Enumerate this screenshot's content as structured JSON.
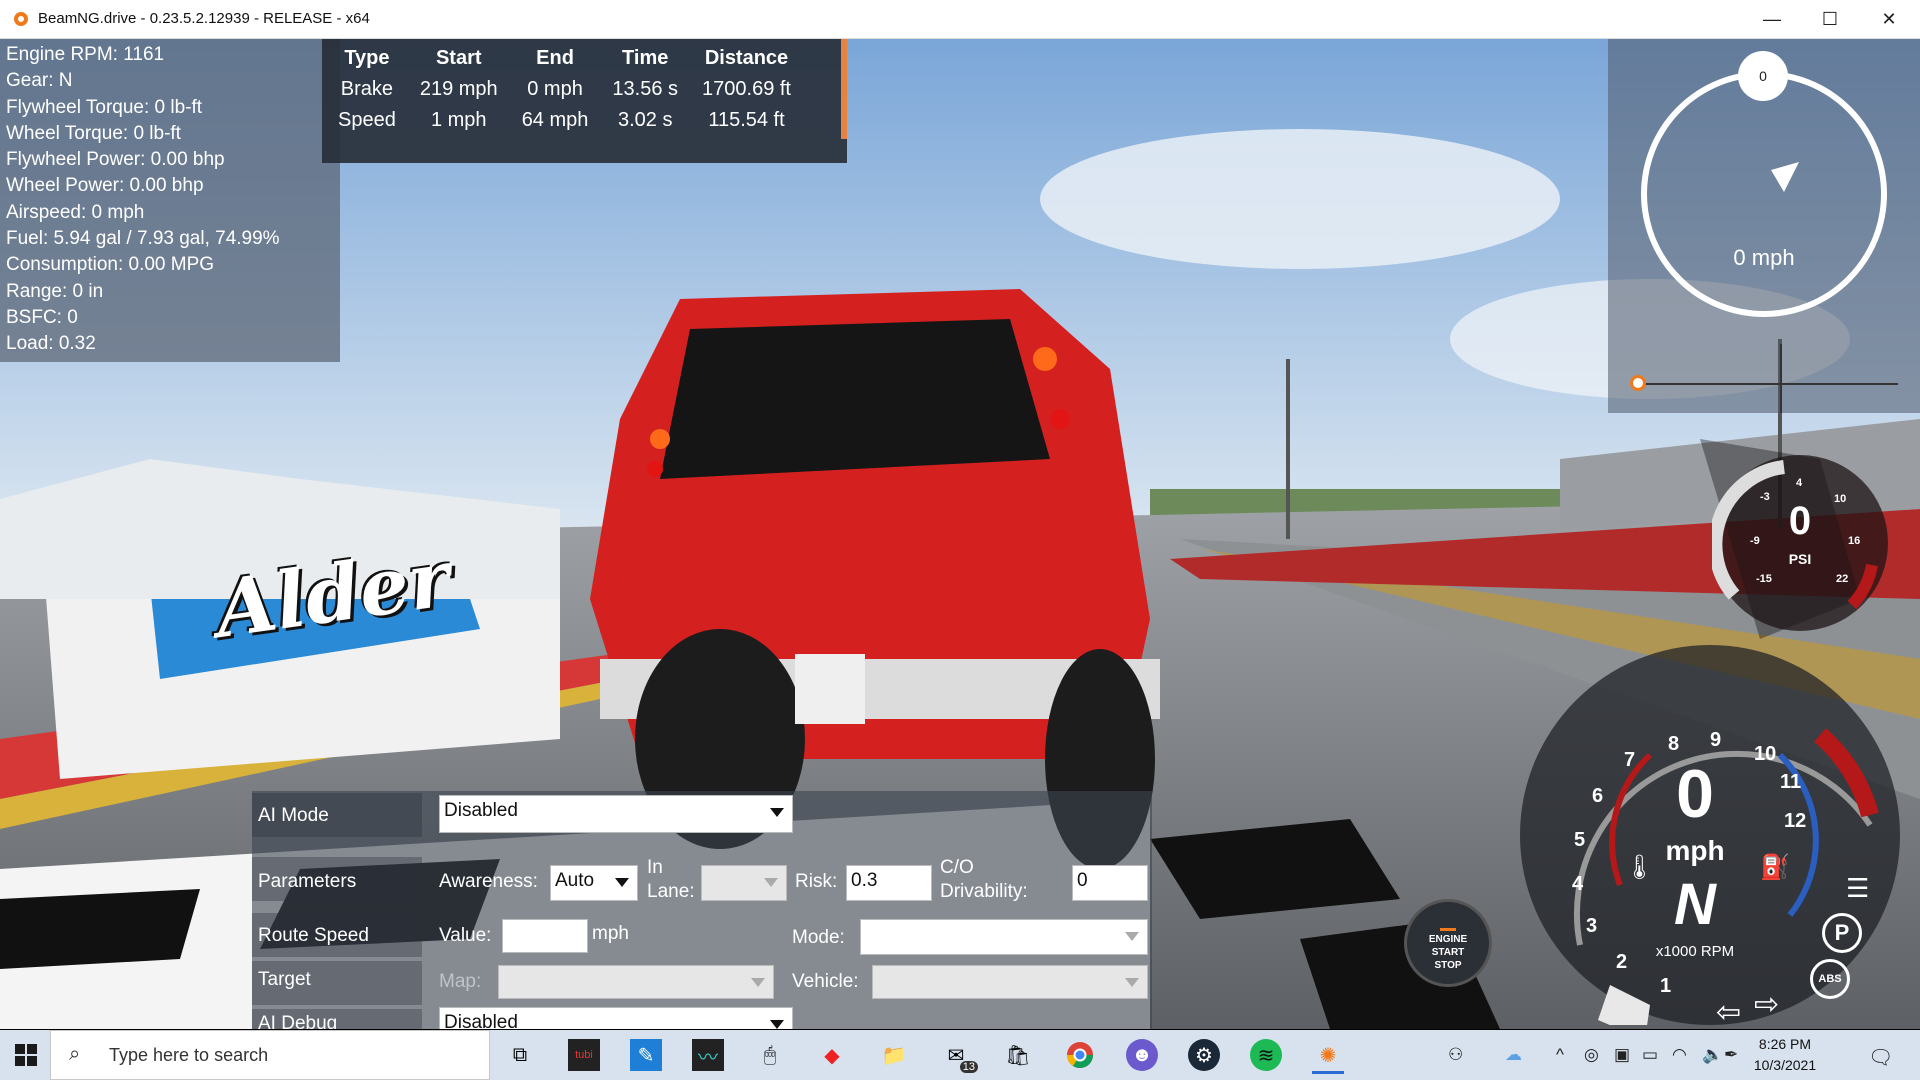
{
  "window": {
    "title": "BeamNG.drive - 0.23.5.2.12939 - RELEASE - x64",
    "minimize": "—",
    "maximize": "☐",
    "close": "✕"
  },
  "debug": {
    "lines": [
      "Engine RPM: 1161",
      "Gear: N",
      "Flywheel Torque: 0 lb-ft",
      "Wheel Torque: 0 lb-ft",
      "Flywheel Power: 0.00 bhp",
      "Wheel Power: 0.00 bhp",
      "Airspeed: 0 mph",
      "Fuel: 5.94 gal / 7.93 gal, 74.99%",
      "Consumption: 0.00 MPG",
      "Range: 0 in",
      "BSFC: 0",
      "Load: 0.32"
    ]
  },
  "perf_table": {
    "headers": [
      "Type",
      "Start",
      "End",
      "Time",
      "Distance"
    ],
    "rows": [
      [
        "Brake",
        "219 mph",
        "0 mph",
        "13.56 s",
        "1700.69 ft"
      ],
      [
        "Speed",
        "1 mph",
        "64 mph",
        "3.02 s",
        "115.54 ft"
      ]
    ]
  },
  "navigation": {
    "heading": "0",
    "speed": "0 mph"
  },
  "boost": {
    "value": "0",
    "unit": "PSI",
    "ticks": [
      "-3",
      "4",
      "10",
      "-9",
      "16",
      "-15",
      "22"
    ]
  },
  "tacho": {
    "speed": "0",
    "unit": "mph",
    "gear": "N",
    "rpm_label": "x1000 RPM",
    "ticks": [
      "1",
      "2",
      "3",
      "4",
      "5",
      "6",
      "7",
      "8",
      "9",
      "10",
      "11",
      "12"
    ],
    "abs": "ABS",
    "park": "P"
  },
  "engine_button": {
    "line1": "ENGINE",
    "line2": "START",
    "line3": "STOP"
  },
  "ai_panel": {
    "mode_label": "AI Mode",
    "mode_value": "Disabled",
    "params_label": "Parameters",
    "awareness_label": "Awareness:",
    "awareness_value": "Auto",
    "inlane_label1": "In",
    "inlane_label2": "Lane:",
    "risk_label": "Risk:",
    "risk_value": "0.3",
    "co_label1": "C/O",
    "co_label2": "Drivability:",
    "co_value": "0",
    "route_label": "Route Speed",
    "value_label": "Value:",
    "value_value": "",
    "value_unit": "mph",
    "route_mode_label": "Mode:",
    "target_label": "Target",
    "map_label": "Map:",
    "vehicle_label": "Vehicle:",
    "debug_label": "AI Debug",
    "debug_value": "Disabled"
  },
  "billboard": {
    "text": "Alder"
  },
  "taskbar": {
    "search_placeholder": "Type here to search",
    "time": "8:26 PM",
    "date": "10/3/2021",
    "mail_badge": "13"
  }
}
